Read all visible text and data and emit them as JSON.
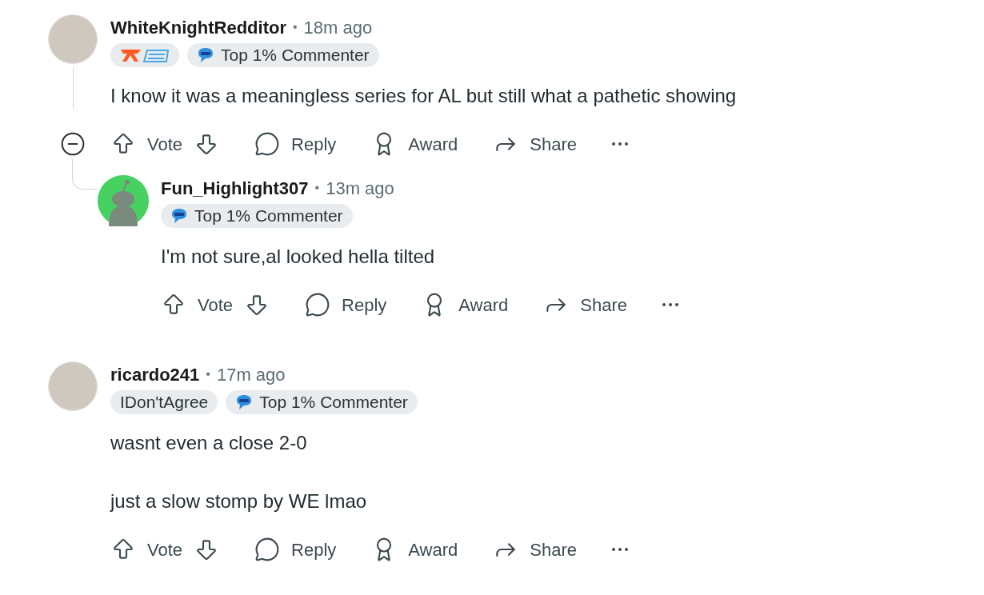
{
  "comments": [
    {
      "avatar": {
        "kind": "photo"
      },
      "author": "WhiteKnightRedditor",
      "separator": "•",
      "time": "18m ago",
      "flairs": [
        {
          "kind": "logo"
        },
        {
          "kind": "badge",
          "text": "Top 1% Commenter"
        }
      ],
      "body": [
        "I know it was a meaningless series for AL but still what a pathetic showing"
      ],
      "collapsible": true,
      "actions": [
        {
          "kind": "vote",
          "label": "Vote"
        },
        {
          "kind": "reply",
          "label": "Reply"
        },
        {
          "kind": "award",
          "label": "Award"
        },
        {
          "kind": "share",
          "label": "Share"
        },
        {
          "kind": "more"
        }
      ],
      "replies": [
        {
          "avatar": {
            "kind": "default"
          },
          "author": "Fun_Highlight307",
          "separator": "•",
          "time": "13m ago",
          "flairs": [
            {
              "kind": "badge",
              "text": "Top 1% Commenter"
            }
          ],
          "body": [
            "I'm not sure,al looked hella tilted"
          ],
          "collapsible": false,
          "actions": [
            {
              "kind": "vote",
              "label": "Vote"
            },
            {
              "kind": "reply",
              "label": "Reply"
            },
            {
              "kind": "award",
              "label": "Award"
            },
            {
              "kind": "share",
              "label": "Share"
            },
            {
              "kind": "more"
            }
          ]
        }
      ]
    },
    {
      "avatar": {
        "kind": "photo"
      },
      "author": "ricardo241",
      "separator": "•",
      "time": "17m ago",
      "flairs": [
        {
          "kind": "text",
          "text": "IDon'tAgree"
        },
        {
          "kind": "badge",
          "text": "Top 1% Commenter"
        }
      ],
      "body": [
        "wasnt even a close 2-0",
        "just a slow stomp by WE lmao"
      ],
      "collapsible": false,
      "actions": [
        {
          "kind": "vote",
          "label": "Vote"
        },
        {
          "kind": "reply",
          "label": "Reply"
        },
        {
          "kind": "award",
          "label": "Award"
        },
        {
          "kind": "share",
          "label": "Share"
        },
        {
          "kind": "more"
        }
      ]
    }
  ]
}
